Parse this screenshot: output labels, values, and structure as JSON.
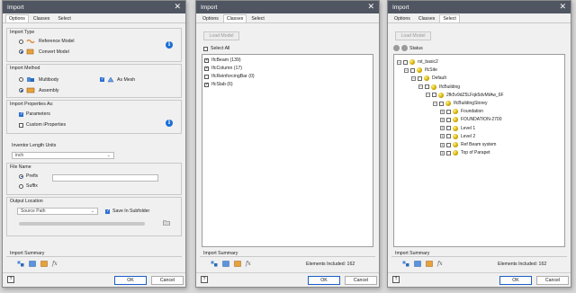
{
  "dialogs": [
    {
      "title": "Import",
      "tabs": [
        "Options",
        "Classes",
        "Select"
      ],
      "active_tab": "Options",
      "import_type": {
        "label": "Import Type",
        "options": [
          "Reference Model",
          "Convert Model"
        ],
        "selected": "Convert Model"
      },
      "import_method": {
        "label": "Import Method",
        "options": [
          "Multibody",
          "Assembly"
        ],
        "selected": "Assembly",
        "as_mesh_label": "As Mesh",
        "as_mesh_checked": true
      },
      "import_properties": {
        "label": "Import Properties As:",
        "options": [
          "Parameters",
          "Custom iProperties"
        ],
        "checked": [
          "Parameters"
        ]
      },
      "length_units": {
        "label": "Inventor Length Units",
        "value": "inch"
      },
      "file_name": {
        "label": "File Name",
        "prefix_label": "Prefix",
        "suffix_label": "Suffix",
        "selected": "Prefix",
        "value": ""
      },
      "output_location": {
        "label": "Output Location",
        "source_value": "Source Path",
        "save_subfolder_label": "Save In Subfolder",
        "save_subfolder_checked": true
      },
      "import_summary_label": "Import Summary",
      "ok_label": "OK",
      "cancel_label": "Cancel"
    },
    {
      "title": "Import",
      "tabs": [
        "Options",
        "Classes",
        "Select"
      ],
      "active_tab": "Classes",
      "load_model_label": "Load Model",
      "select_all_label": "Select All",
      "classes": [
        {
          "label": "IfcBeam (139)",
          "checked": true
        },
        {
          "label": "IfcColumn (17)",
          "checked": true
        },
        {
          "label": "IfcReinforcingBar (0)",
          "checked": false
        },
        {
          "label": "IfcSlab (6)",
          "checked": true
        }
      ],
      "import_summary_label": "Import Summary",
      "elements_included": "Elements Included: 162",
      "ok_label": "OK",
      "cancel_label": "Cancel"
    },
    {
      "title": "Import",
      "tabs": [
        "Options",
        "Classes",
        "Select"
      ],
      "active_tab": "Select",
      "load_model_label": "Load Model",
      "status_label": "Status",
      "tree": [
        {
          "label": "rst_basic2",
          "level": 0,
          "expander": "−"
        },
        {
          "label": "IfcSite",
          "level": 1,
          "expander": "−"
        },
        {
          "label": "Default",
          "level": 2,
          "expander": "−"
        },
        {
          "label": "IfcBuilding",
          "level": 3,
          "expander": "−"
        },
        {
          "label": "2fk5v9dZ5LFqk5dvMtAw_6F",
          "level": 4,
          "expander": "−"
        },
        {
          "label": "IfcBuildingStorey",
          "level": 5,
          "expander": "−"
        },
        {
          "label": "Foundation",
          "level": 6,
          "expander": "+"
        },
        {
          "label": "FOUNDATION-2700",
          "level": 6,
          "expander": "+"
        },
        {
          "label": "Level 1",
          "level": 6,
          "expander": "+"
        },
        {
          "label": "Level 2",
          "level": 6,
          "expander": "+"
        },
        {
          "label": "Ref Beam system",
          "level": 6,
          "expander": "+"
        },
        {
          "label": "Top of Parapet",
          "level": 6,
          "expander": "+"
        }
      ],
      "import_summary_label": "Import Summary",
      "elements_included": "Elements Included: 162",
      "ok_label": "OK",
      "cancel_label": "Cancel"
    }
  ],
  "summary_icons": [
    "summary-assembly-icon",
    "summary-part-icon",
    "summary-cube-icon",
    "summary-fx-icon"
  ],
  "fx_glyph": "fx",
  "help_glyph": "?",
  "close_glyph": "✕",
  "info_glyph": "i",
  "colors": {
    "titlebar": "#505661",
    "accent": "#1a5ec8",
    "info": "#1a6fd6"
  }
}
